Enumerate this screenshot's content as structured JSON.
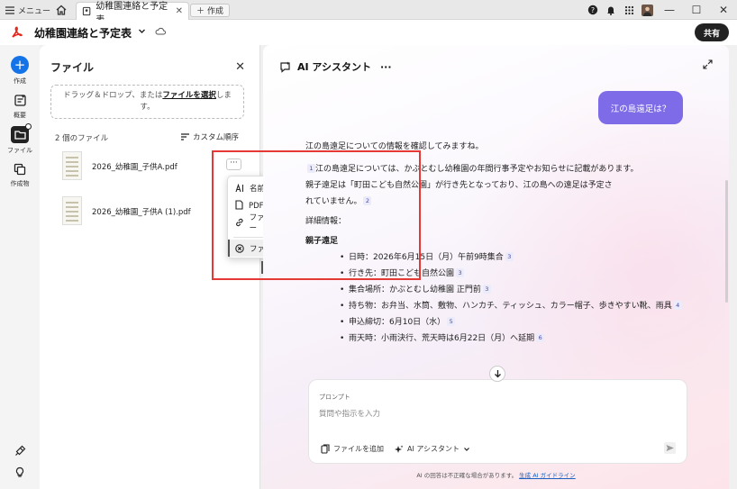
{
  "titlebar": {
    "menu_label": "メニュー",
    "tab_title": "幼稚園連絡と予定表",
    "new_label": "作成"
  },
  "app": {
    "doc_title": "幼稚園連絡と予定表",
    "share_label": "共有"
  },
  "rail": {
    "items": [
      {
        "label": "作成",
        "icon": "plus-icon"
      },
      {
        "label": "概要",
        "icon": "summary-icon"
      },
      {
        "label": "ファイル",
        "icon": "folder-icon"
      },
      {
        "label": "作成物",
        "icon": "artifacts-icon"
      }
    ]
  },
  "file_panel": {
    "title": "ファイル",
    "dropzone_text1": "ドラッグ＆ドロップ、または",
    "dropzone_link": "ファイルを選択",
    "dropzone_text2": "しま",
    "dropzone_text3": "す。",
    "count": "2 個のファイル",
    "sort_label": "カスタム順序",
    "files": [
      {
        "name": "2026_幼稚園_子供A.pdf"
      },
      {
        "name": "2026_幼稚園_子供A (1).pdf"
      }
    ],
    "more_label": "···"
  },
  "context_menu": {
    "items": [
      {
        "label": "名前を変更",
        "icon": "rename-icon"
      },
      {
        "label": "PDF 形式でダウンロード",
        "icon": "pdf-icon"
      },
      {
        "label": "ファイルへのリンクをコピー",
        "icon": "link-icon"
      },
      {
        "label": "ファイルを削除",
        "icon": "delete-icon"
      }
    ]
  },
  "ai_panel": {
    "title": "AI アシスタント",
    "more": "···",
    "user_message": "江の島遠足は？",
    "intro": "江の島遠足についての情報を確認してみますね。",
    "p1": "江の島遠足については、かぶとむし幼稚園の年間行事予定やお知らせに記載があります。",
    "p2a": "親子遠足は「町田こども自然公園」が行き先となっており、江の島への遠足は予定さ",
    "p2b": "れていません。",
    "p2_ref": "2",
    "p1_ref": "1",
    "p3": "詳細情報：",
    "section": "親子遠足",
    "bullets": [
      {
        "text": "日時：2026年6月15日（月）午前9時集合",
        "ref": "3"
      },
      {
        "text": "行き先：町田こども自然公園",
        "ref": "3"
      },
      {
        "text": "集合場所：かぶとむし幼稚園 正門前",
        "ref": "3"
      },
      {
        "text": "持ち物：お弁当、水筒、敷物、ハンカチ、ティッシュ、カラー帽子、歩きやすい靴、雨具",
        "ref": "4"
      },
      {
        "text": "申込締切：6月10日（水）",
        "ref": "5"
      },
      {
        "text": "雨天時：小雨決行、荒天時は6月22日（月）へ延期",
        "ref": "6"
      }
    ],
    "prompt_label": "プロンプト",
    "prompt_placeholder": "質問や指示を入力",
    "add_file_label": "ファイルを追加",
    "assistant_label": "AI アシスタント",
    "footnote": "AI の回答は不正確な場合があります。",
    "footnote_link": "生成 AI ガイドライン"
  }
}
